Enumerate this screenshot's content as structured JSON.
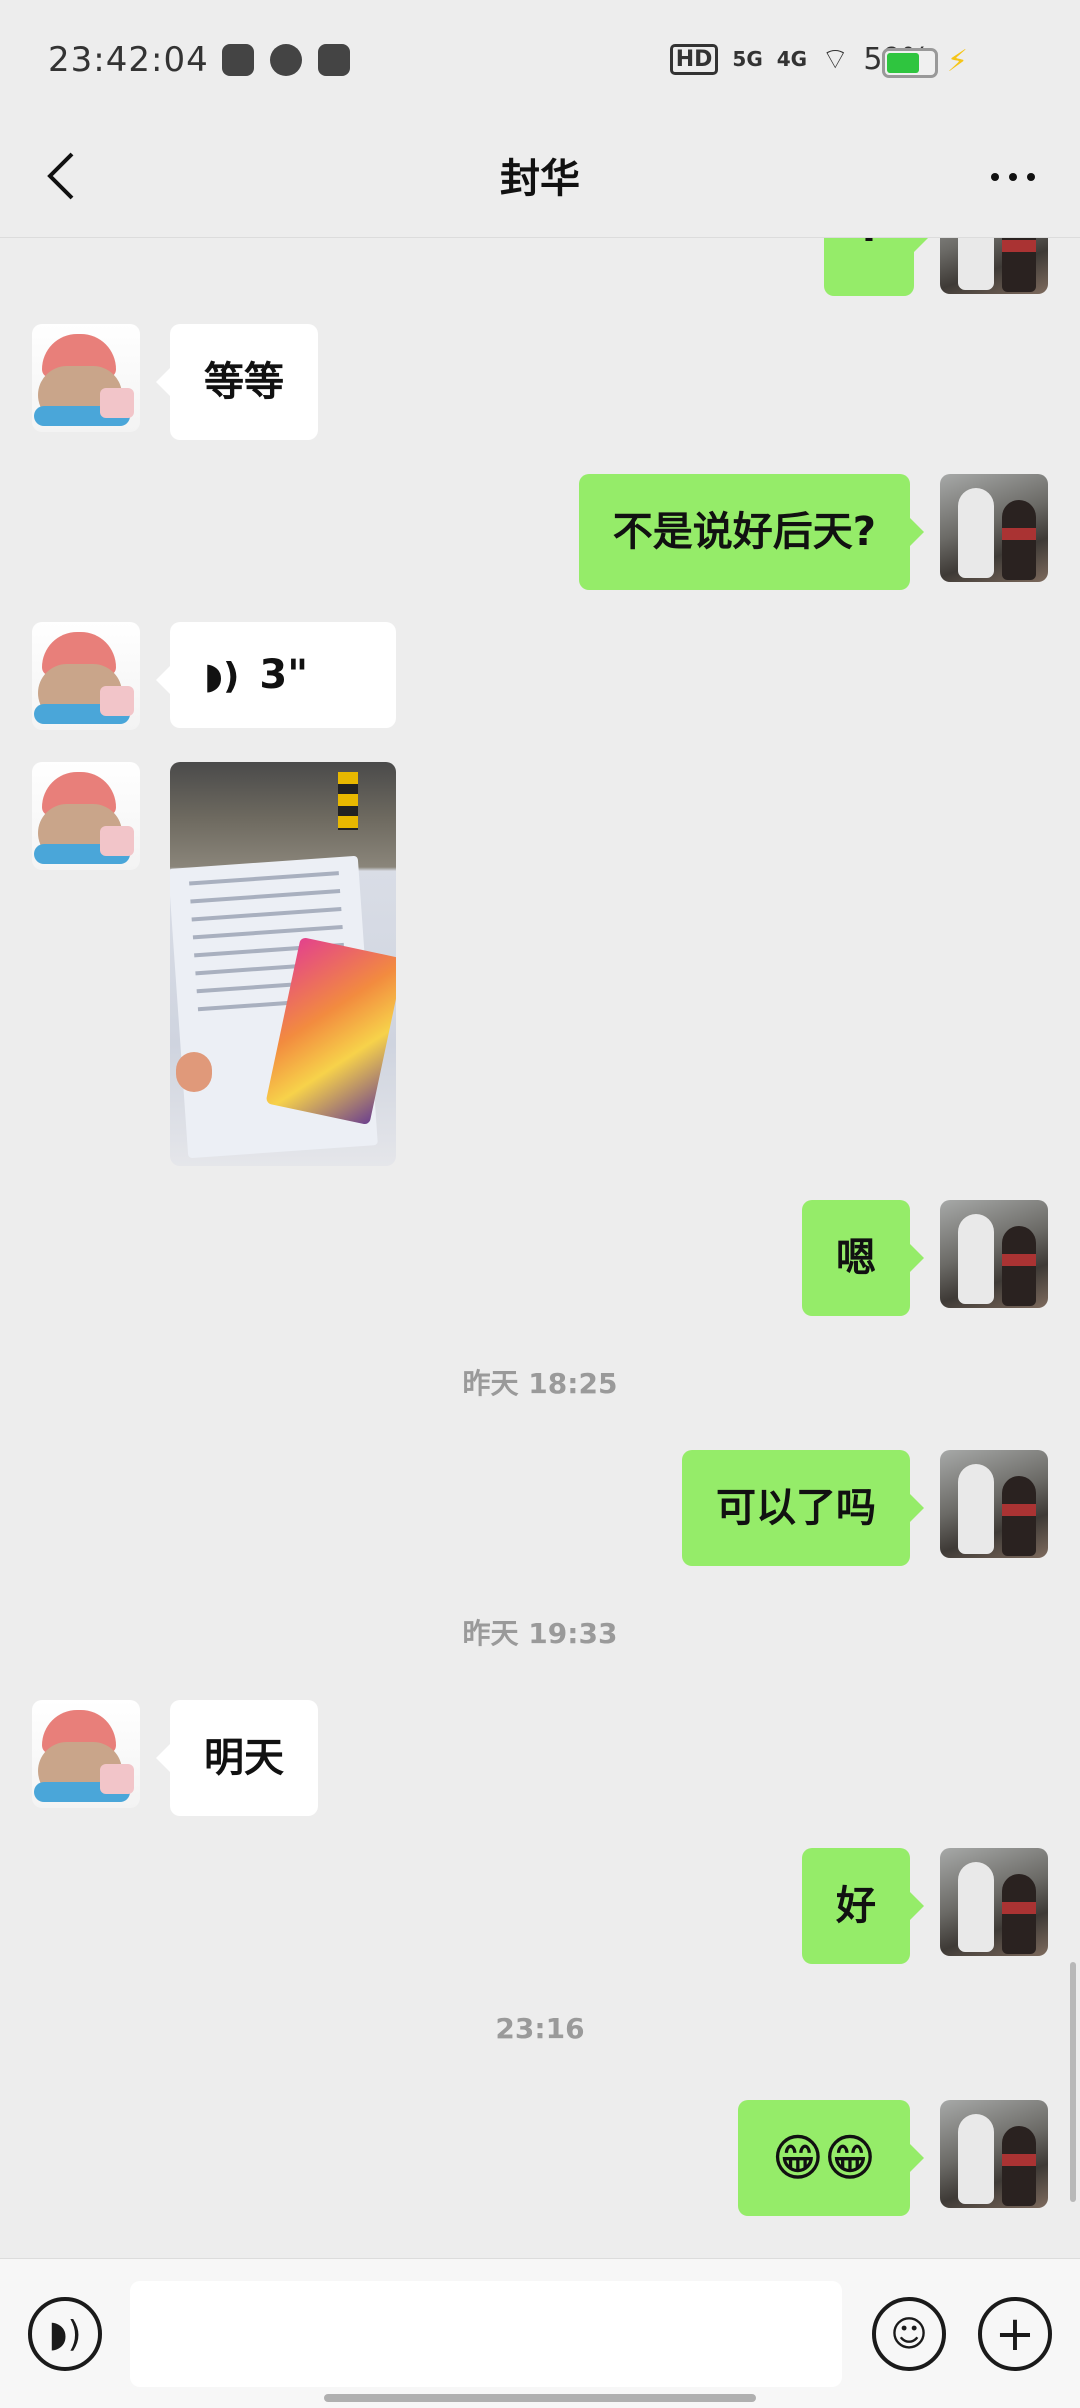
{
  "status_bar": {
    "time": "23:42:04",
    "hd_label": "HD",
    "signal_5g": "5G",
    "signal_4g": "4G",
    "battery_percent": "59%",
    "battery_level": 0.59
  },
  "nav": {
    "title": "封华",
    "back_icon": "chevron-left-icon",
    "more_icon": "more-dots-icon"
  },
  "messages": [
    {
      "side": "right",
      "type": "text",
      "text": "·"
    },
    {
      "side": "left",
      "type": "text",
      "text": "等等"
    },
    {
      "side": "right",
      "type": "text",
      "text": "不是说好后天?"
    },
    {
      "side": "left",
      "type": "voice",
      "text": "3\""
    },
    {
      "side": "left",
      "type": "image",
      "text": ""
    },
    {
      "side": "right",
      "type": "text",
      "text": "嗯"
    },
    {
      "type": "time",
      "text": "昨天 18:25"
    },
    {
      "side": "right",
      "type": "text",
      "text": "可以了吗"
    },
    {
      "type": "time",
      "text": "昨天 19:33"
    },
    {
      "side": "left",
      "type": "text",
      "text": "明天"
    },
    {
      "side": "right",
      "type": "text",
      "text": "好"
    },
    {
      "type": "time",
      "text": "23:16"
    },
    {
      "side": "right",
      "type": "text",
      "text": "😁😁"
    }
  ],
  "input_bar": {
    "voice_icon": "voice-icon",
    "input_placeholder": "",
    "emoji_icon": "emoji-icon",
    "plus_icon": "plus-icon"
  }
}
